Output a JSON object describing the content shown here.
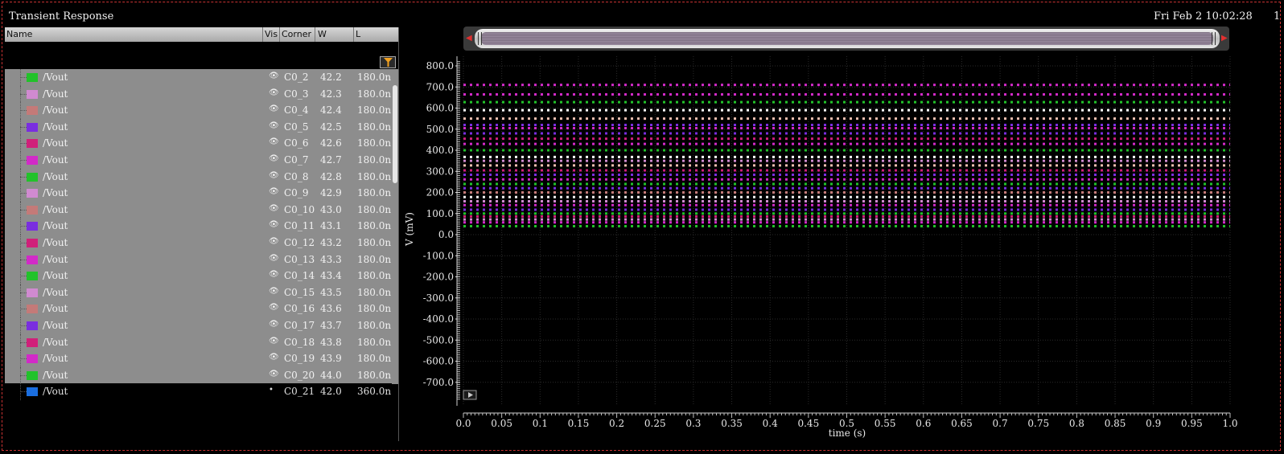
{
  "window": {
    "title": "Transient Response",
    "datetime": "Fri Feb 2 10:02:28",
    "page_number": "1"
  },
  "panel": {
    "columns": [
      "Name",
      "Vis",
      "Corner",
      "W",
      "L"
    ],
    "rows": [
      {
        "name": "/Vout",
        "corner": "C0_2",
        "w": "42.2",
        "l": "180.0n",
        "color": "#22c22a",
        "selected": true
      },
      {
        "name": "/Vout",
        "corner": "C0_3",
        "w": "42.3",
        "l": "180.0n",
        "color": "#d08ad0",
        "selected": true
      },
      {
        "name": "/Vout",
        "corner": "C0_4",
        "w": "42.4",
        "l": "180.0n",
        "color": "#c47a78",
        "selected": true
      },
      {
        "name": "/Vout",
        "corner": "C0_5",
        "w": "42.5",
        "l": "180.0n",
        "color": "#7a2ee0",
        "selected": true
      },
      {
        "name": "/Vout",
        "corner": "C0_6",
        "w": "42.6",
        "l": "180.0n",
        "color": "#d0207a",
        "selected": true
      },
      {
        "name": "/Vout",
        "corner": "C0_7",
        "w": "42.7",
        "l": "180.0n",
        "color": "#d22ac8",
        "selected": true
      },
      {
        "name": "/Vout",
        "corner": "C0_8",
        "w": "42.8",
        "l": "180.0n",
        "color": "#22c22a",
        "selected": true
      },
      {
        "name": "/Vout",
        "corner": "C0_9",
        "w": "42.9",
        "l": "180.0n",
        "color": "#d08ad0",
        "selected": true
      },
      {
        "name": "/Vout",
        "corner": "C0_10",
        "w": "43.0",
        "l": "180.0n",
        "color": "#c47a78",
        "selected": true
      },
      {
        "name": "/Vout",
        "corner": "C0_11",
        "w": "43.1",
        "l": "180.0n",
        "color": "#7a2ee0",
        "selected": true
      },
      {
        "name": "/Vout",
        "corner": "C0_12",
        "w": "43.2",
        "l": "180.0n",
        "color": "#d0207a",
        "selected": true
      },
      {
        "name": "/Vout",
        "corner": "C0_13",
        "w": "43.3",
        "l": "180.0n",
        "color": "#d22ac8",
        "selected": true
      },
      {
        "name": "/Vout",
        "corner": "C0_14",
        "w": "43.4",
        "l": "180.0n",
        "color": "#22c22a",
        "selected": true
      },
      {
        "name": "/Vout",
        "corner": "C0_15",
        "w": "43.5",
        "l": "180.0n",
        "color": "#d08ad0",
        "selected": true
      },
      {
        "name": "/Vout",
        "corner": "C0_16",
        "w": "43.6",
        "l": "180.0n",
        "color": "#c47a78",
        "selected": true
      },
      {
        "name": "/Vout",
        "corner": "C0_17",
        "w": "43.7",
        "l": "180.0n",
        "color": "#7a2ee0",
        "selected": true
      },
      {
        "name": "/Vout",
        "corner": "C0_18",
        "w": "43.8",
        "l": "180.0n",
        "color": "#d0207a",
        "selected": true
      },
      {
        "name": "/Vout",
        "corner": "C0_19",
        "w": "43.9",
        "l": "180.0n",
        "color": "#d22ac8",
        "selected": true
      },
      {
        "name": "/Vout",
        "corner": "C0_20",
        "w": "44.0",
        "l": "180.0n",
        "color": "#22c22a",
        "selected": true
      },
      {
        "name": "/Vout",
        "corner": "C0_21",
        "w": "42.0",
        "l": "360.0n",
        "color": "#1a6ee0",
        "selected": false
      }
    ]
  },
  "icons": {
    "visible": "eye-icon",
    "filter": "filter-icon",
    "play": "play-icon"
  },
  "chart_data": {
    "type": "line",
    "xlabel": "time (s)",
    "ylabel": "V (mV)",
    "xlim": [
      0,
      1.0
    ],
    "ylim": [
      -780,
      830
    ],
    "x_ticks": [
      "0.0",
      "0.05",
      "0.1",
      "0.15",
      "0.2",
      "0.25",
      "0.3",
      "0.35",
      "0.4",
      "0.45",
      "0.5",
      "0.55",
      "0.6",
      "0.65",
      "0.7",
      "0.75",
      "0.8",
      "0.85",
      "0.9",
      "0.95",
      "1.0"
    ],
    "y_ticks": [
      "800.0",
      "700.0",
      "600.0",
      "500.0",
      "400.0",
      "300.0",
      "200.0",
      "100.0",
      "0.0",
      "-100.0",
      "-200.0",
      "-300.0",
      "-400.0",
      "-500.0",
      "-600.0",
      "-700.0"
    ],
    "grid": true,
    "series": [
      {
        "values": [
          40,
          40
        ],
        "color": "#22c22a"
      },
      {
        "values": [
          58,
          58
        ],
        "color": "#d22ac8"
      },
      {
        "values": [
          72,
          72
        ],
        "color": "#d08ad0"
      },
      {
        "values": [
          86,
          86
        ],
        "color": "#d0207a"
      },
      {
        "values": [
          100,
          100
        ],
        "color": "#22c22a"
      },
      {
        "values": [
          118,
          118
        ],
        "color": "#7a2ee0"
      },
      {
        "values": [
          140,
          140
        ],
        "color": "#d22ac8"
      },
      {
        "values": [
          158,
          158
        ],
        "color": "#d08ad0"
      },
      {
        "values": [
          178,
          178
        ],
        "color": "#f0f0f0"
      },
      {
        "values": [
          200,
          200
        ],
        "color": "#c47a78"
      },
      {
        "values": [
          220,
          220
        ],
        "color": "#7a2ee0"
      },
      {
        "values": [
          240,
          240
        ],
        "color": "#22c22a"
      },
      {
        "values": [
          262,
          262
        ],
        "color": "#d22ac8"
      },
      {
        "values": [
          284,
          284
        ],
        "color": "#7a2ee0"
      },
      {
        "values": [
          305,
          305
        ],
        "color": "#d0207a"
      },
      {
        "values": [
          328,
          328
        ],
        "color": "#f0c0b0"
      },
      {
        "values": [
          350,
          350
        ],
        "color": "#d08ad0"
      },
      {
        "values": [
          368,
          368
        ],
        "color": "#ffffff"
      },
      {
        "values": [
          400,
          400
        ],
        "color": "#22c22a"
      },
      {
        "values": [
          430,
          430
        ],
        "color": "#d22ac8"
      },
      {
        "values": [
          455,
          455
        ],
        "color": "#d0207a"
      },
      {
        "values": [
          480,
          480
        ],
        "color": "#7a2ee0"
      },
      {
        "values": [
          505,
          505
        ],
        "color": "#d22ac8"
      },
      {
        "values": [
          520,
          520
        ],
        "color": "#7a2ee0"
      },
      {
        "values": [
          550,
          550
        ],
        "color": "#f0c0b0"
      },
      {
        "values": [
          590,
          590
        ],
        "color": "#ffffff"
      },
      {
        "values": [
          628,
          628
        ],
        "color": "#22c22a"
      },
      {
        "values": [
          665,
          665
        ],
        "color": "#d22ac8"
      },
      {
        "values": [
          710,
          710
        ],
        "color": "#d22ac8"
      }
    ]
  }
}
